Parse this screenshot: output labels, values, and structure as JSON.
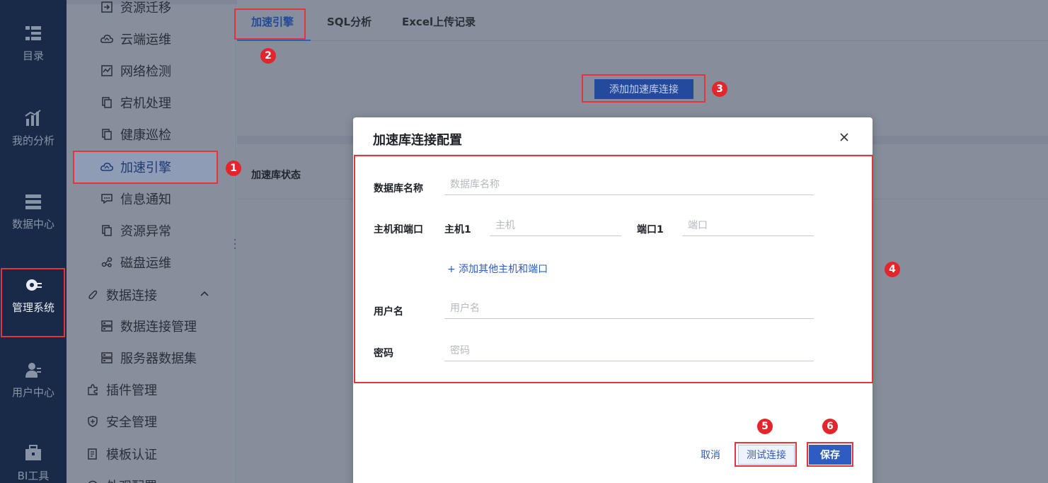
{
  "rail": {
    "items": [
      {
        "label": "目录",
        "icon": "catalog-icon"
      },
      {
        "label": "我的分析",
        "icon": "analysis-icon"
      },
      {
        "label": "数据中心",
        "icon": "data-center-icon"
      },
      {
        "label": "管理系统",
        "icon": "gear-icon"
      },
      {
        "label": "用户中心",
        "icon": "user-icon"
      },
      {
        "label": "BI工具",
        "icon": "toolbox-icon"
      }
    ]
  },
  "submenu": {
    "items": [
      {
        "label": "资源迁移",
        "icon": "migrate-icon"
      },
      {
        "label": "云端运维",
        "icon": "cloud-icon"
      },
      {
        "label": "网络检测",
        "icon": "network-icon"
      },
      {
        "label": "宕机处理",
        "icon": "copy-icon"
      },
      {
        "label": "健康巡检",
        "icon": "copy-icon"
      },
      {
        "label": "加速引擎",
        "icon": "cloud-icon"
      },
      {
        "label": "信息通知",
        "icon": "message-icon"
      },
      {
        "label": "资源异常",
        "icon": "copy-icon"
      },
      {
        "label": "磁盘运维",
        "icon": "disk-icon"
      },
      {
        "label": "数据连接",
        "icon": "link-icon"
      },
      {
        "label": "数据连接管理",
        "icon": "server-icon"
      },
      {
        "label": "服务器数据集",
        "icon": "server-icon"
      },
      {
        "label": "插件管理",
        "icon": "puzzle-icon"
      },
      {
        "label": "安全管理",
        "icon": "shield-icon"
      },
      {
        "label": "模板认证",
        "icon": "template-icon"
      },
      {
        "label": "外观配置",
        "icon": "palette-icon"
      }
    ]
  },
  "tabs": [
    {
      "label": "加速引擎"
    },
    {
      "label": "SQL分析"
    },
    {
      "label": "Excel上传记录"
    }
  ],
  "main": {
    "add_button": "添加加速库连接",
    "status_label": "加速库状态"
  },
  "dialog": {
    "title": "加速库连接配置",
    "db_name_label": "数据库名称",
    "db_name_placeholder": "数据库名称",
    "host_port_label": "主机和端口",
    "host_label": "主机1",
    "host_placeholder": "主机",
    "port_label": "端口1",
    "port_placeholder": "端口",
    "add_host": "+ 添加其他主机和端口",
    "username_label": "用户名",
    "username_placeholder": "用户名",
    "password_label": "密码",
    "password_placeholder": "密码",
    "cancel": "取消",
    "test": "测试连接",
    "save": "保存"
  },
  "annotations": [
    "1",
    "2",
    "3",
    "4",
    "5",
    "6"
  ],
  "colors": {
    "primary": "#2f5cc0",
    "annotation": "#e5242c",
    "rail": "#182a48"
  }
}
